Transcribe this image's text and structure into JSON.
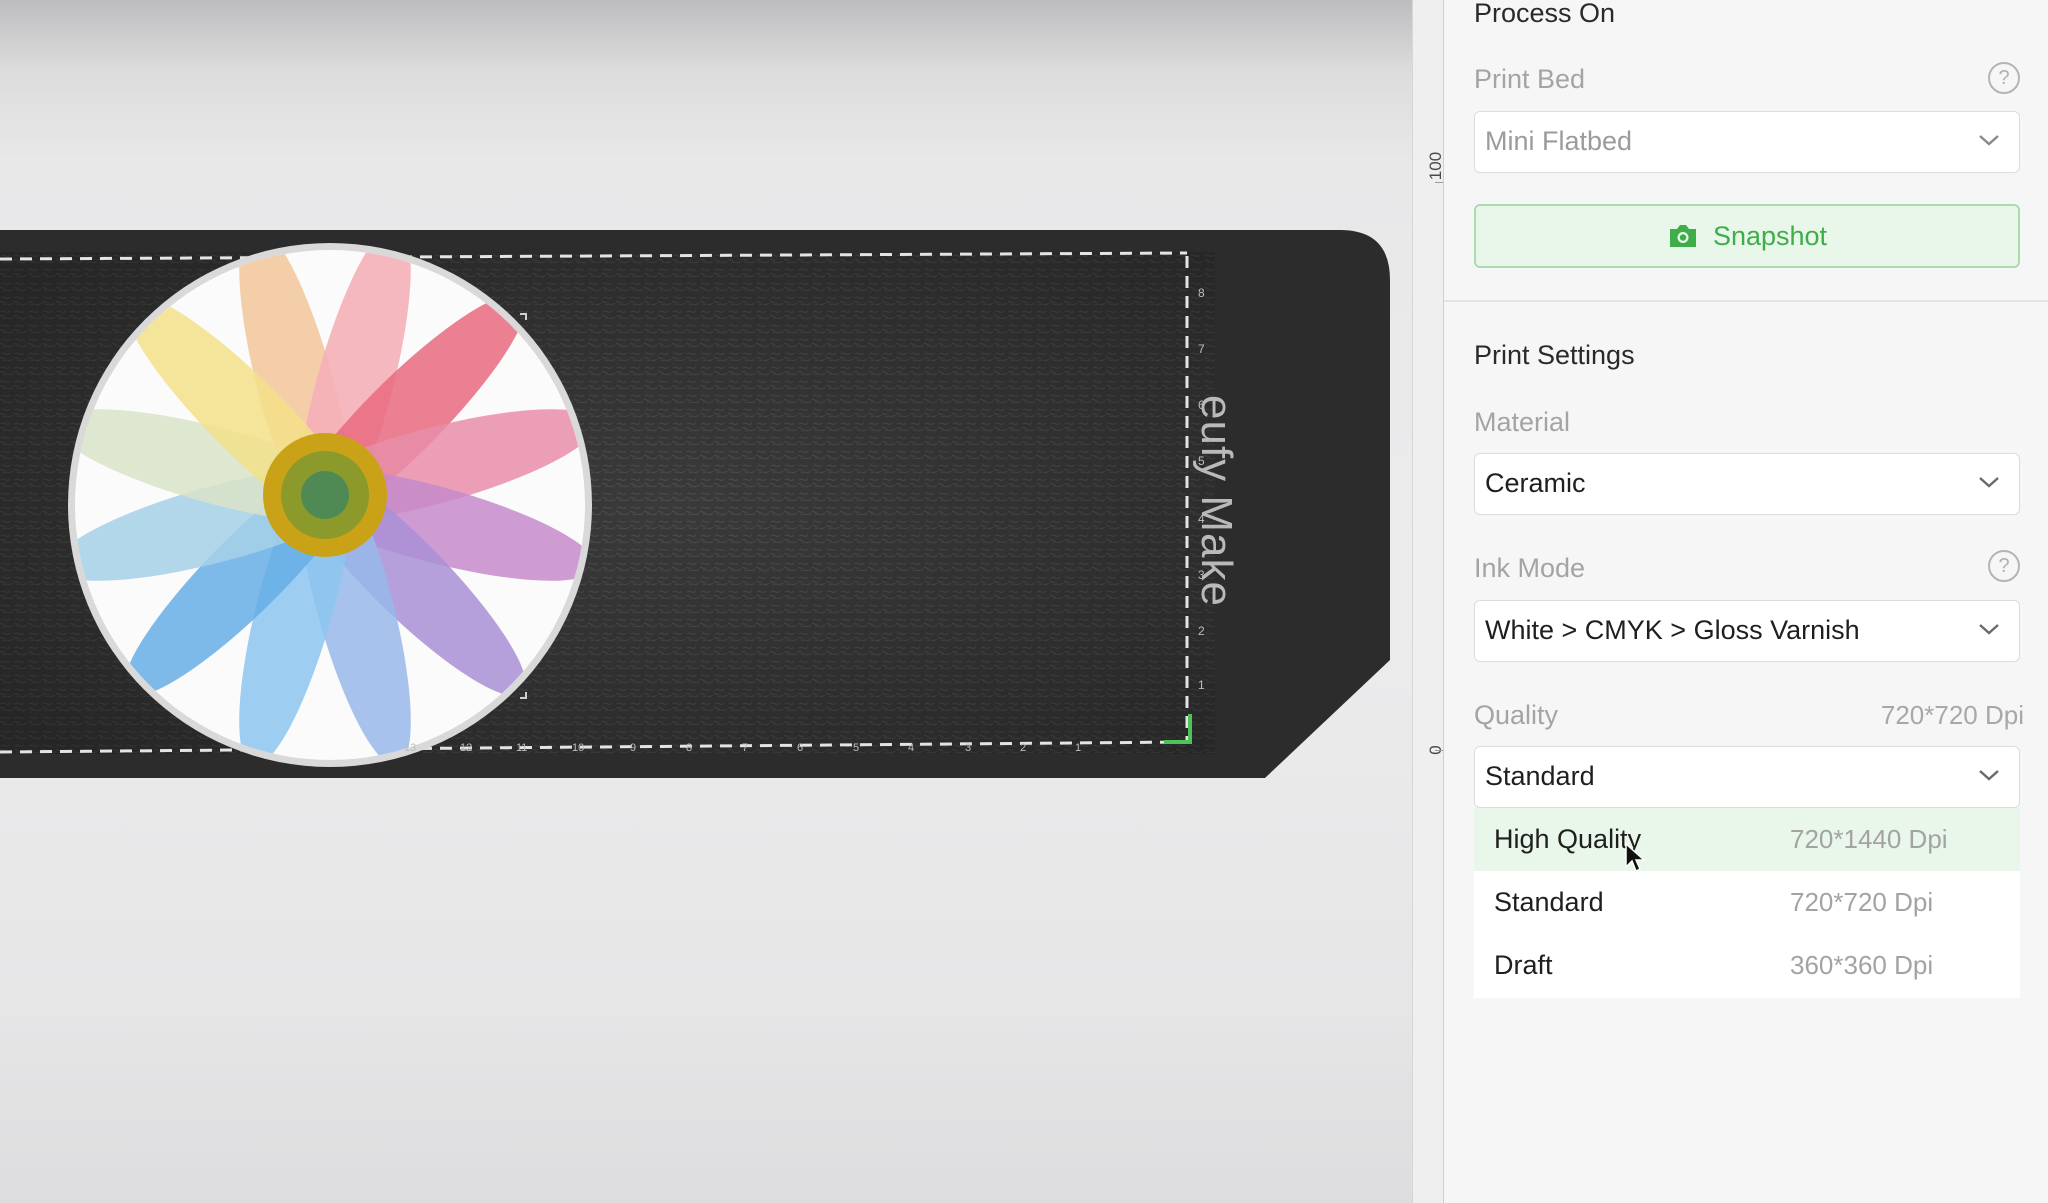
{
  "canvas": {
    "brand_text": "eufy Make",
    "ruler_marks": [
      "8",
      "7",
      "6",
      "5",
      "4",
      "3",
      "2",
      "1"
    ],
    "bottom_marks": [
      "1",
      "2",
      "3",
      "4",
      "5",
      "6",
      "7",
      "8",
      "9",
      "10",
      "11",
      "12",
      "13"
    ]
  },
  "ruler": {
    "labels": [
      "100",
      "0"
    ]
  },
  "panel": {
    "process_on_title": "Process On",
    "print_bed": {
      "label": "Print Bed",
      "value": "Mini Flatbed"
    },
    "snapshot_label": "Snapshot",
    "print_settings_title": "Print Settings",
    "material": {
      "label": "Material",
      "value": "Ceramic"
    },
    "ink_mode": {
      "label": "Ink Mode",
      "value": "White > CMYK > Gloss Varnish"
    },
    "quality": {
      "label": "Quality",
      "current_dpi": "720*720 Dpi",
      "value": "Standard",
      "options": [
        {
          "name": "High Quality",
          "dpi": "720*1440 Dpi"
        },
        {
          "name": "Standard",
          "dpi": "720*720 Dpi"
        },
        {
          "name": "Draft",
          "dpi": "360*360 Dpi"
        }
      ]
    },
    "help_glyph": "?"
  },
  "colors": {
    "accent_green": "#3fae4a",
    "highlight_green": "#e9f6ea",
    "bed_dark": "#2c2c2c"
  }
}
